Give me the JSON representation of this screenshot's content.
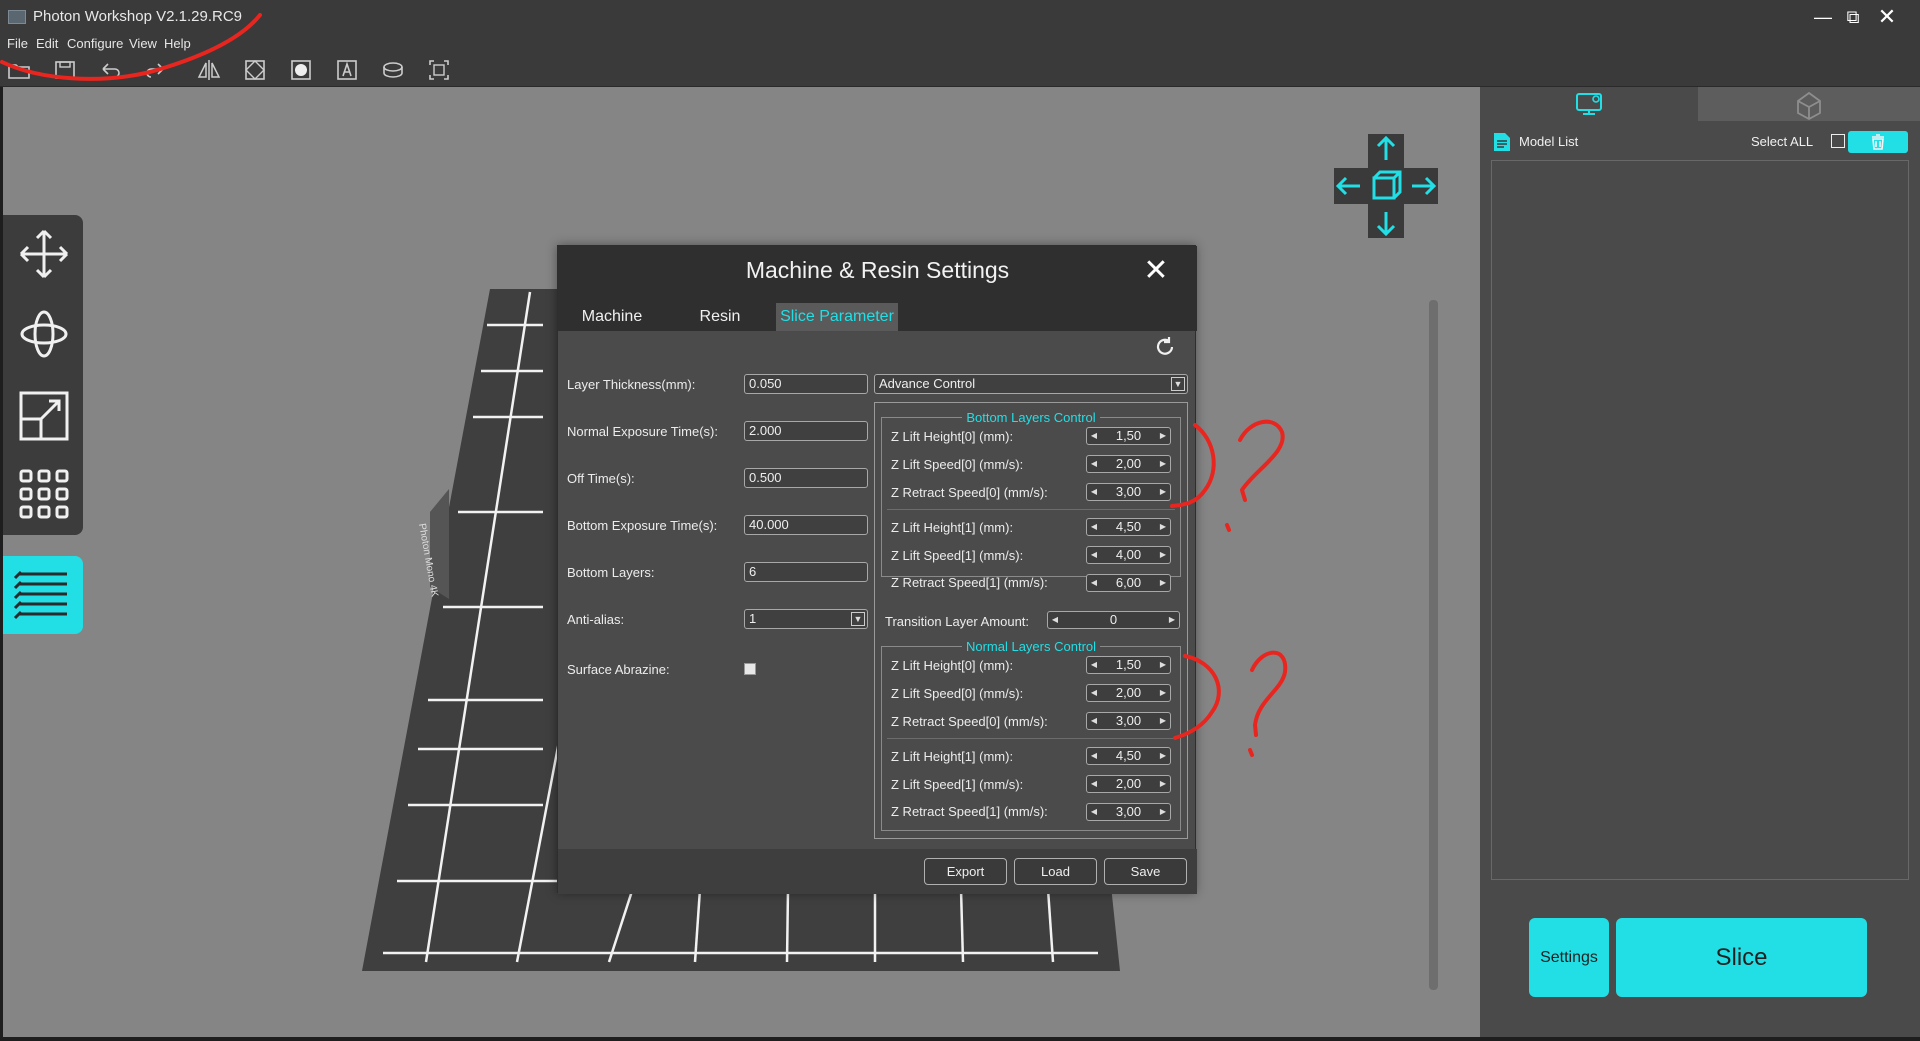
{
  "window": {
    "title": "Photon Workshop V2.1.29.RC9"
  },
  "menu": {
    "file": "File",
    "edit": "Edit",
    "configure": "Configure",
    "view": "View",
    "help": "Help"
  },
  "printer": {
    "plate_label": "Photon Mono 4K"
  },
  "right_panel": {
    "model_list_label": "Model List",
    "select_all_label": "Select ALL",
    "settings_button": "Settings",
    "slice_button": "Slice"
  },
  "dialog": {
    "title": "Machine & Resin Settings",
    "tabs": {
      "machine": "Machine",
      "resin": "Resin",
      "slice_parameter": "Slice Parameter"
    },
    "left_fields": [
      {
        "label": "Layer Thickness(mm):",
        "value": "0.050"
      },
      {
        "label": "Normal Exposure Time(s):",
        "value": "2.000"
      },
      {
        "label": "Off Time(s):",
        "value": "0.500"
      },
      {
        "label": "Bottom Exposure Time(s):",
        "value": "40.000"
      },
      {
        "label": "Bottom Layers:",
        "value": "6"
      },
      {
        "label": "Anti-alias:",
        "value": "1"
      }
    ],
    "surface_abrazine_label": "Surface Abrazine:",
    "control_mode": "Advance Control",
    "bottom_group_title": "Bottom Layers Control",
    "bottom_rows": [
      {
        "label": "Z Lift Height[0] (mm):",
        "value": "1,50"
      },
      {
        "label": "Z Lift Speed[0] (mm/s):",
        "value": "2,00"
      },
      {
        "label": "Z Retract Speed[0] (mm/s):",
        "value": "3,00"
      },
      {
        "label": "Z Lift Height[1] (mm):",
        "value": "4,50"
      },
      {
        "label": "Z Lift Speed[1] (mm/s):",
        "value": "4,00"
      },
      {
        "label": "Z Retract Speed[1] (mm/s):",
        "value": "6,00"
      }
    ],
    "transition_label": "Transition Layer Amount:",
    "transition_value": "0",
    "normal_group_title": "Normal Layers Control",
    "normal_rows": [
      {
        "label": "Z Lift Height[0] (mm):",
        "value": "1,50"
      },
      {
        "label": "Z Lift Speed[0] (mm/s):",
        "value": "2,00"
      },
      {
        "label": "Z Retract Speed[0] (mm/s):",
        "value": "3,00"
      },
      {
        "label": "Z Lift Height[1] (mm):",
        "value": "4,50"
      },
      {
        "label": "Z Lift Speed[1] (mm/s):",
        "value": "2,00"
      },
      {
        "label": "Z Retract Speed[1] (mm/s):",
        "value": "3,00"
      }
    ],
    "buttons": {
      "export": "Export",
      "load": "Load",
      "save": "Save"
    }
  },
  "colors": {
    "accent": "#22dfe6",
    "annotation": "#e8261f"
  }
}
